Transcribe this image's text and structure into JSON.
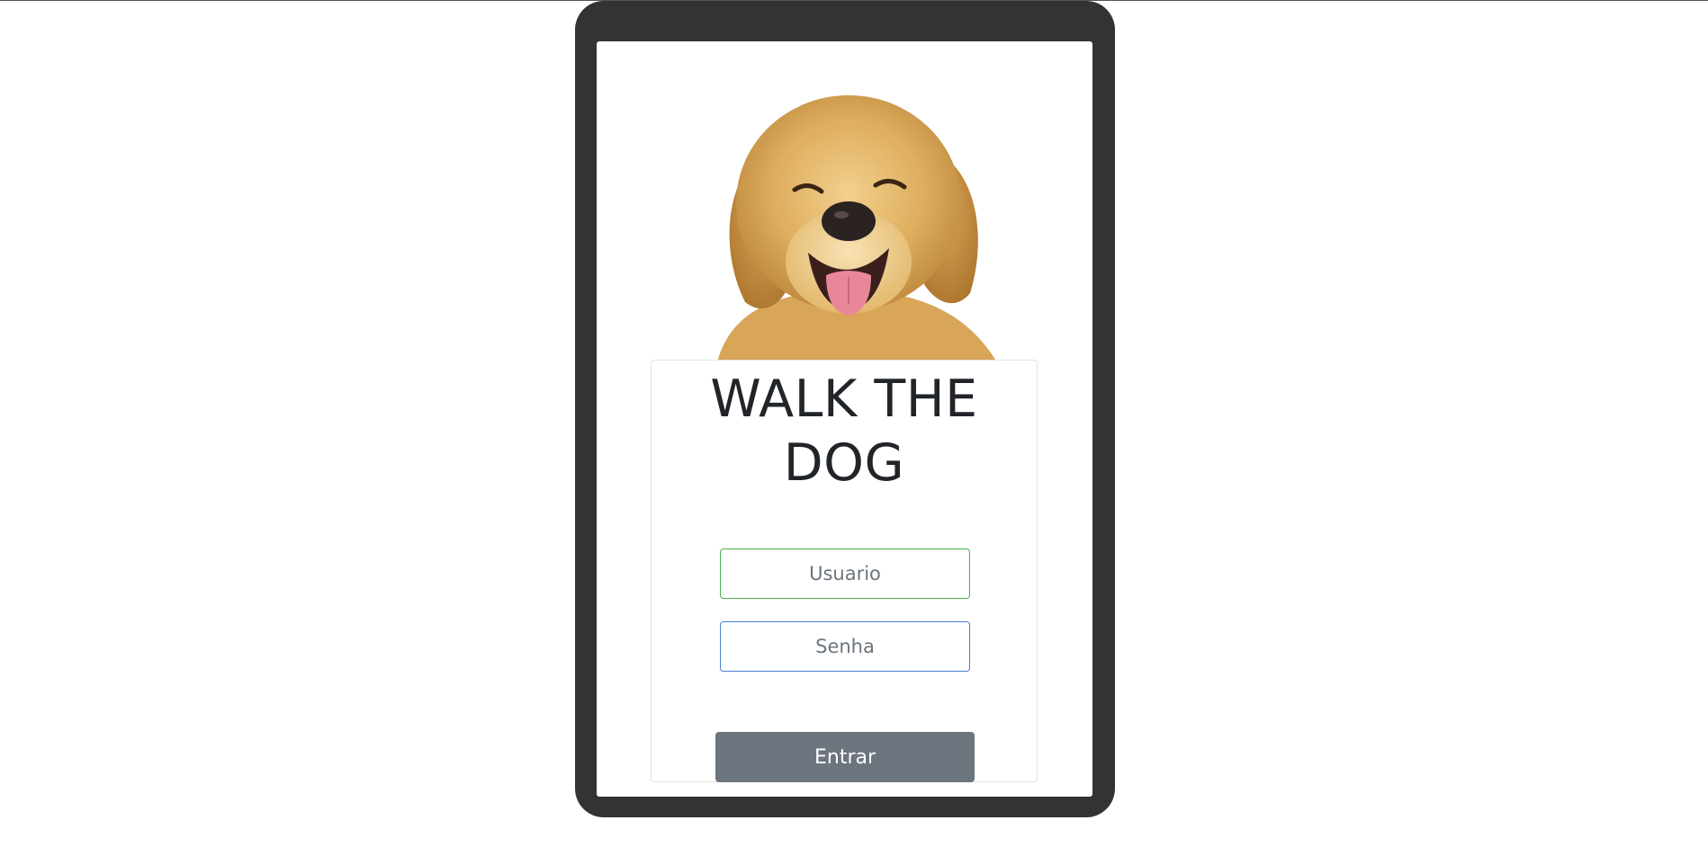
{
  "app": {
    "title": "WALK THE DOG"
  },
  "hero": {
    "image_name": "golden-retriever-photo"
  },
  "form": {
    "username_placeholder": "Usuario",
    "username_value": "",
    "password_placeholder": "Senha",
    "password_value": "",
    "submit_label": "Entrar"
  },
  "colors": {
    "device_frame": "#333333",
    "title_text": "#212529",
    "username_border": "#4caf50",
    "password_border": "#4a7fd6",
    "button_bg": "#6c757d",
    "button_text": "#ffffff"
  }
}
